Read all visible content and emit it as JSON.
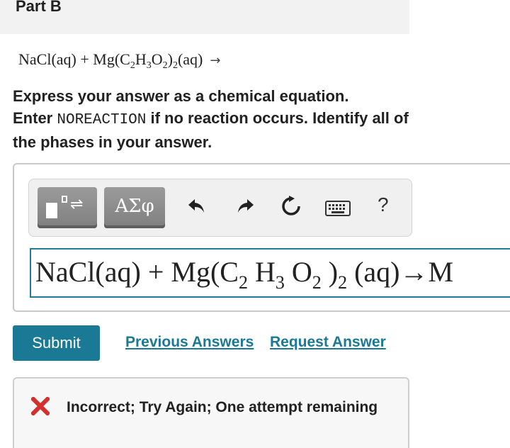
{
  "part": {
    "title": "Part B"
  },
  "reaction": {
    "lhs1": "NaCl(aq)",
    "plus": "+",
    "mg": "Mg(C",
    "sub_c": "2",
    "h": "H",
    "sub_h": "3",
    "o": "O",
    "sub_o": "2",
    "close": ")",
    "sub_n": "2",
    "state": "(aq)",
    "arrow": "→"
  },
  "instructions": {
    "line1": "Express your answer as a chemical equation.",
    "enter": "Enter ",
    "keyword": "NOREACTION",
    "rest": " if no reaction occurs. Identify all of the phases in your answer."
  },
  "toolbar": {
    "greek_label": "ΑΣφ",
    "help_label": "?",
    "icons": [
      "templates-icon",
      "greek-letters-icon",
      "undo-icon",
      "redo-icon",
      "reset-icon",
      "keyboard-icon",
      "help-icon"
    ]
  },
  "answer_input": {
    "part1": "NaCl(aq) + Mg(C",
    "sub_c": "2",
    "h": " H",
    "sub_h": "3",
    "o": " O",
    "sub_o": "2",
    "close": " )",
    "sub_n": "2",
    "tail": " (aq)→M"
  },
  "actions": {
    "submit_label": "Submit",
    "previous_answers": "Previous Answers",
    "request_answer": "Request Answer"
  },
  "feedback": {
    "message": "Incorrect; Try Again; One attempt remaining",
    "status_color": "#d32f2f"
  },
  "colors": {
    "accent": "#1a7a96",
    "header_bg": "#f2f2f2",
    "toolbar_button": "#8a8a8a"
  }
}
